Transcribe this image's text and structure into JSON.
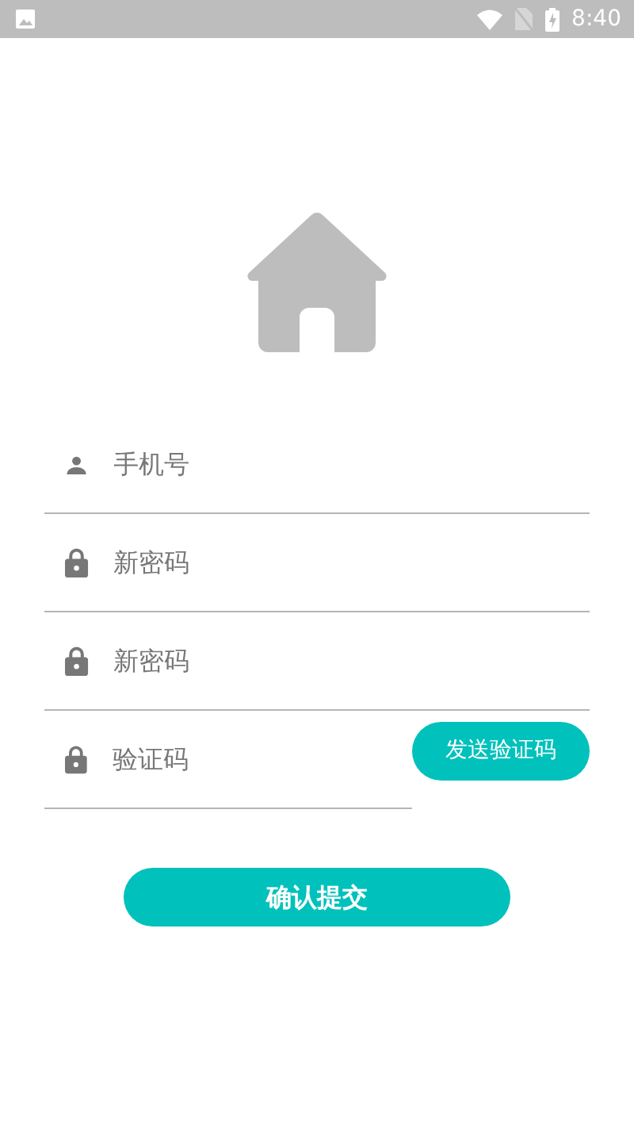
{
  "status_bar": {
    "time": "8:40"
  },
  "fields": [
    {
      "kind": "phone",
      "placeholder": "手机号"
    },
    {
      "kind": "password",
      "placeholder": "新密码"
    },
    {
      "kind": "password",
      "placeholder": "新密码"
    },
    {
      "kind": "code",
      "placeholder": "验证码",
      "button": "发送验证码"
    }
  ],
  "submit": "确认提交"
}
